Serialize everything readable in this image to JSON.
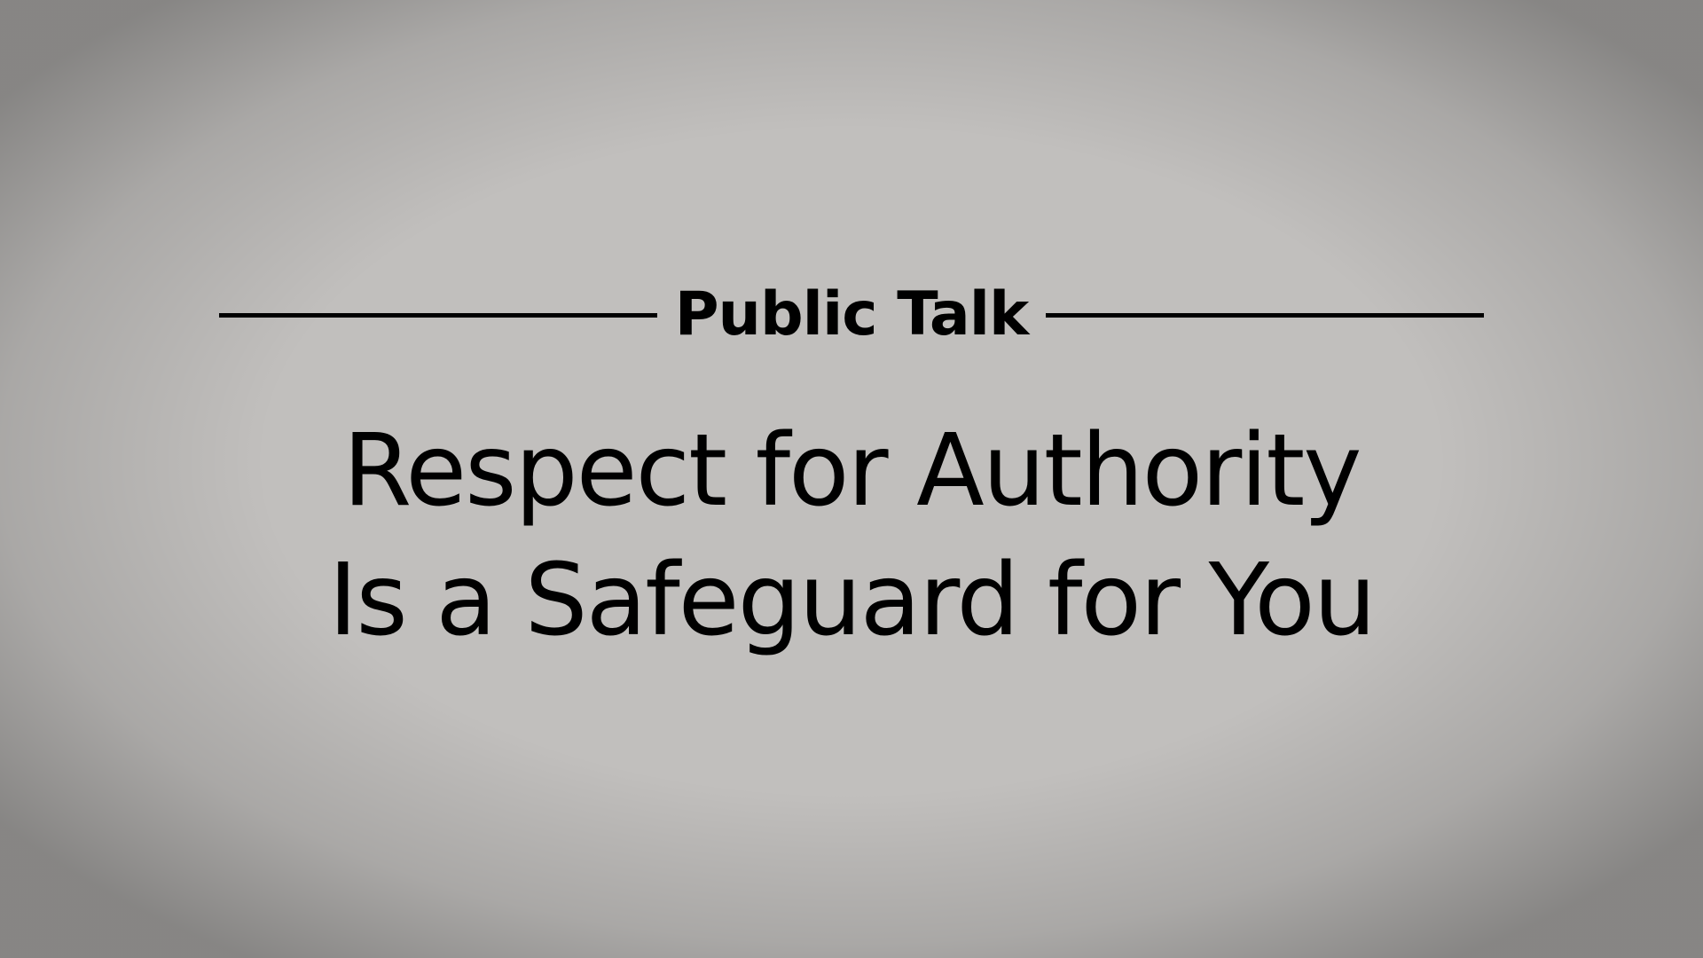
{
  "slide": {
    "label": "Public Talk",
    "title_lines": [
      "Respect for Authority",
      "Is a Safeguard for You"
    ]
  },
  "colors": {
    "background": "#c1bfbd",
    "text": "#000000"
  }
}
